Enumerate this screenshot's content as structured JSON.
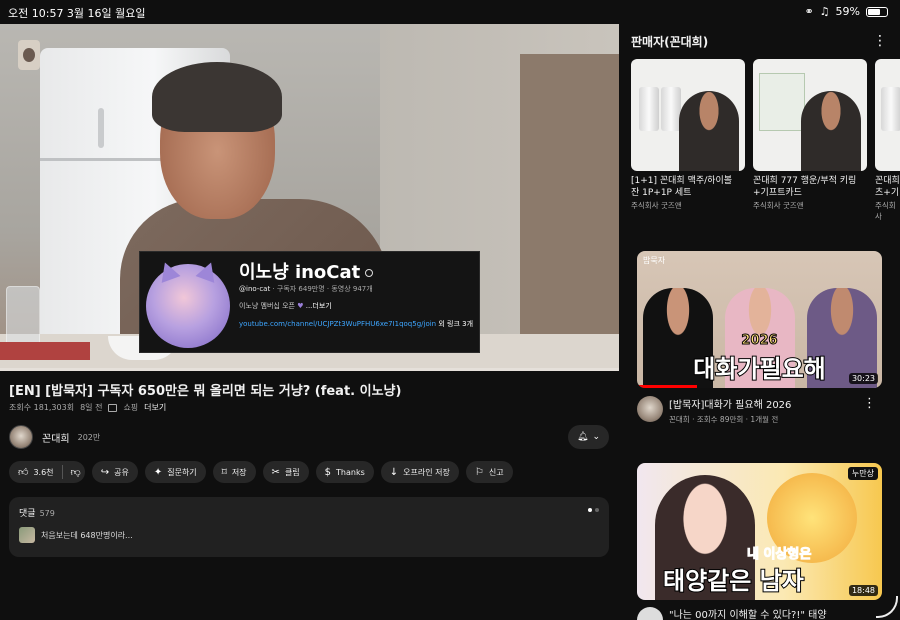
{
  "status_bar": {
    "time_date": "오전 10:57   3월 16일 월요일",
    "battery": "59%",
    "battery_level": 0.59
  },
  "video": {
    "title": "[EN] [밥묵자] 구독자 650만은 뭐 올리면 되는 거냥? (feat. 이노냥)",
    "views": "조회수 181,303회",
    "age": "8일 전",
    "shopping": "쇼핑",
    "more": "더보기"
  },
  "overlay_card": {
    "name": "이노냥 inoCat",
    "handle": "@ino-cat",
    "subs": "· 구독자 649만명 · 동영상 947개",
    "membership": "이노냥 멤버십 오픈",
    "more": "...더보기",
    "link": "youtube.com/channel/UCJPZt3WuPFHU6xe7I1qoq5g/join",
    "link_extra": "외 링크 3개"
  },
  "channel": {
    "name": "꼰대희",
    "subscribers": "202만"
  },
  "actions": {
    "like": "3.6천",
    "share": "공유",
    "ask": "질문하기",
    "save": "저장",
    "clip": "클립",
    "thanks": "Thanks",
    "offline": "오프라인 저장",
    "report": "신고"
  },
  "comments": {
    "label": "댓글",
    "count": "579",
    "first": "처음보는데 648만명이라..."
  },
  "panel": {
    "title": "판매자(꼰대희)",
    "products": [
      {
        "name": "[1+1] 꼰대희 맥주/하이볼\n잔 1P+1P 세트",
        "seller": "주식회사 굿즈앤"
      },
      {
        "name": "꼰대희 777 행운/부적 키링\n+기프트카드",
        "seller": "주식회사 굿즈앤"
      },
      {
        "name": "꼰대희\n츠+기",
        "seller": "주식회사"
      }
    ]
  },
  "recommended": [
    {
      "title": "[밥묵자]대화가 필요해 2026",
      "channel_views": "꼰대희 · 조회수 89만회 · 1개월 전",
      "duration": "30:23",
      "caption1": "2026",
      "caption2": "대화가필요해",
      "tag": "밥묵자"
    },
    {
      "title": "\"나는 00까지 이해할 수 있다?!\" 태양",
      "duration": "18:48",
      "caption1": "내 이상형은",
      "caption2": "태양같은 남자",
      "tag": "누만상"
    }
  ],
  "colors": {
    "background": "#0f0f0f",
    "chip": "#272727",
    "link": "#3ea6ff",
    "accent_red": "#ff0000"
  }
}
